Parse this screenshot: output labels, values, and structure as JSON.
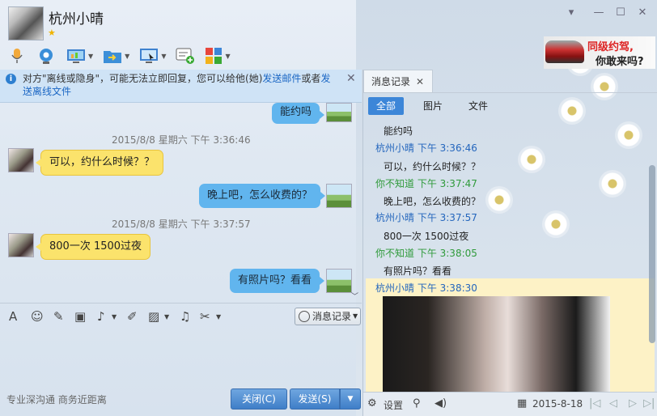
{
  "header": {
    "name": "杭州小晴",
    "star": "★"
  },
  "window_controls": {
    "menu": "▾",
    "minimize": "—",
    "maximize": "☐",
    "close": "✕"
  },
  "ad": {
    "line1": "同级约驾,",
    "line2": "你敢来吗?"
  },
  "notice": {
    "pre": "对方\"离线或隐身\"，可能无法立即回复，您可以给他(她)",
    "link1": "发送邮件",
    "mid": "或者",
    "link2": "发送离线文件",
    "close": "✕"
  },
  "chat": {
    "messages": [
      {
        "text": "能约吗"
      },
      {
        "timestamp": "2015/8/8 星期六 下午 3:36:46"
      },
      {
        "text": "可以，约什么时候？？"
      },
      {
        "text": "晚上吧，怎么收费的？"
      },
      {
        "timestamp": "2015/8/8 星期六 下午 3:37:57"
      },
      {
        "text": "800一次 1500过夜"
      },
      {
        "text": "有照片吗？看看"
      }
    ]
  },
  "input_toolbar": {
    "history_label": "消息记录"
  },
  "footer": {
    "slogan": "专业深沟通 商务近距离",
    "close_label": "关闭(C)",
    "send_label": "发送(S)"
  },
  "history": {
    "tab_label": "消息记录",
    "filters": [
      "全部",
      "图片",
      "文件"
    ],
    "entries": [
      {
        "type": "txt",
        "text": "能约吗"
      },
      {
        "type": "her",
        "text": "杭州小晴  下午 3:36:46"
      },
      {
        "type": "txt",
        "text": "可以，约什么时候？？"
      },
      {
        "type": "me",
        "text": "你不知道  下午 3:37:47"
      },
      {
        "type": "txt",
        "text": "晚上吧，怎么收费的？"
      },
      {
        "type": "her",
        "text": "杭州小晴  下午 3:37:57"
      },
      {
        "type": "txt",
        "text": "800一次 1500过夜"
      },
      {
        "type": "me",
        "text": "你不知道  下午 3:38:05"
      },
      {
        "type": "txt",
        "text": "有照片吗？看看"
      },
      {
        "type": "her",
        "text": "杭州小晴  下午 3:38:30"
      }
    ],
    "settings_label": "设置",
    "date": "2015-8-18"
  }
}
